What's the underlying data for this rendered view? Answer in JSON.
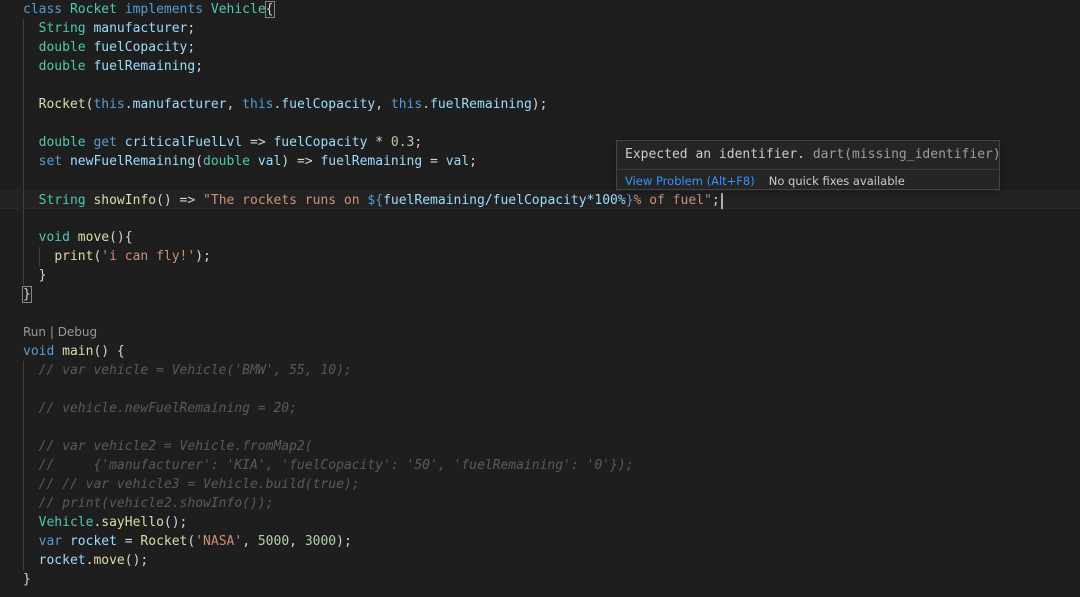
{
  "code_lens": {
    "run": "Run",
    "separator": " | ",
    "debug": "Debug"
  },
  "code": {
    "l1": {
      "kw_class": "class",
      "name": "Rocket",
      "kw_implements": "implements",
      "iface": "Vehicle",
      "brace": "{"
    },
    "l2": {
      "type": "String",
      "field": "manufacturer",
      "end": ";"
    },
    "l3": {
      "type": "double",
      "field": "fuelCopacity",
      "end": ";"
    },
    "l4": {
      "type": "double",
      "field": "fuelRemaining",
      "end": ";"
    },
    "l6": {
      "ctor": "Rocket",
      "open": "(",
      "this1": "this",
      "f1": ".manufacturer",
      "sep1": ", ",
      "this2": "this",
      "f2": ".fuelCopacity",
      "sep2": ", ",
      "this3": "this",
      "f3": ".fuelRemaining",
      "close": ");"
    },
    "l8": {
      "type": "double",
      "kw_get": "get",
      "getter": "criticalFuelLvl",
      "arrow": " => ",
      "field": "fuelCopacity",
      "op": " * ",
      "num": "0.3",
      "end": ";"
    },
    "l9": {
      "kw_set": "set",
      "setter": "newFuelRemaining",
      "open": "(",
      "type": "double",
      "param": "val",
      "close": ") => ",
      "field": "fuelRemaining",
      "op": " = ",
      "val": "val",
      "end": ";"
    },
    "l11": {
      "type": "String",
      "fn": "showInfo",
      "parens": "() => ",
      "str_start": "\"The rockets runs on ",
      "interp_open": "${",
      "expr": "fuelRemaining/fuelCopacity*100%",
      "interp_close": "}",
      "str_end": "% of fuel\"",
      "end": ";"
    },
    "l13": {
      "type": "void",
      "fn": "move",
      "rest": "(){"
    },
    "l14": {
      "fn": "print",
      "open": "(",
      "str": "'i can fly!'",
      "close": ");"
    },
    "l15": {
      "brace": "}"
    },
    "l16": {
      "brace": "}"
    },
    "l19": {
      "type": "void",
      "fn": "main",
      "rest": "() {"
    },
    "l20": {
      "comment": "// var vehicle = Vehicle('BMW', 55, 10);"
    },
    "l22": {
      "comment": "// vehicle.newFuelRemaining = 20;"
    },
    "l24": {
      "comment": "// var vehicle2 = Vehicle.fromMap2("
    },
    "l25": {
      "comment": "//     {'manufacturer': 'KIA', 'fuelCopacity': '50', 'fuelRemaining': '0'});"
    },
    "l26": {
      "comment": "// // var vehicle3 = Vehicle.build(true);"
    },
    "l27": {
      "comment": "// print(vehicle2.showInfo());"
    },
    "l28": {
      "cls": "Vehicle",
      "dot": ".",
      "fn": "sayHello",
      "rest": "();"
    },
    "l29": {
      "kw_var": "var",
      "name": "rocket",
      "eq": " = ",
      "cls": "Rocket",
      "open": "(",
      "s1": "'NASA'",
      "c1": ", ",
      "n1": "5000",
      "c2": ", ",
      "n2": "3000",
      "close": ");"
    },
    "l30": {
      "obj": "rocket",
      "dot": ".",
      "fn": "move",
      "rest": "();"
    },
    "l31": {
      "brace": "}"
    }
  },
  "hover": {
    "message": "Expected an identifier.",
    "source": "dart(missing_identifier)",
    "view_problem": "View Problem (Alt+F8)",
    "no_fixes": "No quick fixes available"
  },
  "colors": {
    "background": "#1e1e1e",
    "keyword": "#569cd6",
    "type": "#4ec9b0",
    "function": "#dcdcaa",
    "variable": "#9cdcfe",
    "string": "#ce9178",
    "number": "#b5cea8",
    "comment": "#5a5a5a",
    "link": "#3794ff"
  }
}
